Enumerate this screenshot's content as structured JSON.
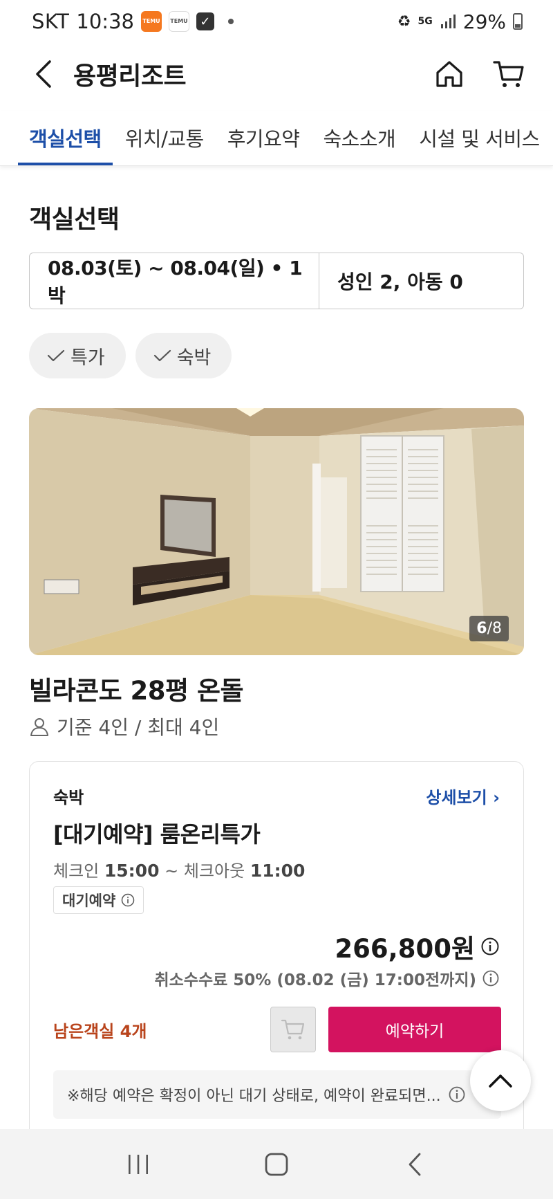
{
  "status_bar": {
    "carrier": "SKT",
    "time": "10:38",
    "app1": "TEMU",
    "app2": "TEMU",
    "network": "5G",
    "battery": "29%"
  },
  "header": {
    "title": "용평리조트"
  },
  "tabs": [
    {
      "label": "객실선택",
      "active": true
    },
    {
      "label": "위치/교통",
      "active": false
    },
    {
      "label": "후기요약",
      "active": false
    },
    {
      "label": "숙소소개",
      "active": false
    },
    {
      "label": "시설 및 서비스",
      "active": false
    }
  ],
  "section": {
    "title": "객실선택",
    "dates": "08.03(토) ~ 08.04(일) • 1박",
    "guests": "성인 2, 아동 0"
  },
  "filters": [
    {
      "label": "특가"
    },
    {
      "label": "숙박"
    }
  ],
  "room": {
    "photo_index": "6",
    "photo_total": "/8",
    "name": "빌라콘도 28평 온돌",
    "capacity": "기준 4인 / 최대 4인"
  },
  "rate": {
    "type": "숙박",
    "detail_link": "상세보기",
    "name": "[대기예약] 룸온리특가",
    "checkin_label": "체크인",
    "checkin_time": "15:00",
    "separator": "~",
    "checkout_label": "체크아웃",
    "checkout_time": "11:00",
    "badge": "대기예약",
    "price": "266,800원",
    "cancel_fee": "취소수수료 50% (08.02 (금) 17:00전까지)",
    "rooms_left": "남은객실 4개",
    "book_label": "예약하기",
    "notice": "※해당 예약은 확정이 아닌 대기 상태로, 예약이 완료되면..."
  },
  "colors": {
    "accent_blue": "#1d4fa8",
    "book_pink": "#d3135f",
    "rooms_left_orange": "#b9441c"
  }
}
